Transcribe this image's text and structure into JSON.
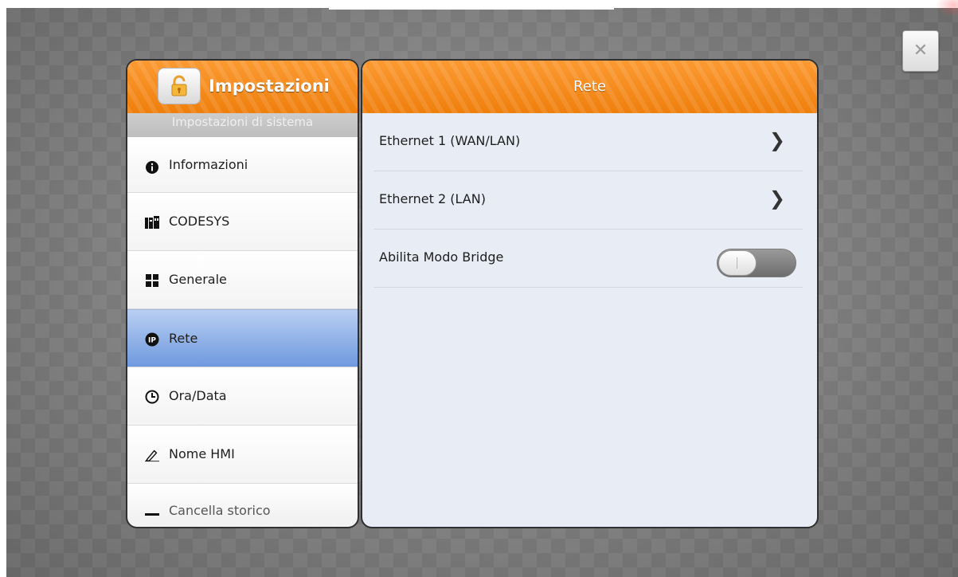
{
  "left_panel": {
    "title": "Impostazioni",
    "subheader": "Impostazioni di sistema",
    "items": [
      {
        "label": "Informazioni",
        "icon": "info-icon",
        "active": false
      },
      {
        "label": "CODESYS",
        "icon": "codesys-icon",
        "active": false
      },
      {
        "label": "Generale",
        "icon": "grid-icon",
        "active": false
      },
      {
        "label": "Rete",
        "icon": "ip-icon",
        "active": true
      },
      {
        "label": "Ora/Data",
        "icon": "clock-icon",
        "active": false
      },
      {
        "label": "Nome HMI",
        "icon": "pencil-icon",
        "active": false
      },
      {
        "label": "Cancella storico",
        "icon": "minus-icon",
        "active": false
      }
    ]
  },
  "right_panel": {
    "title": "Rete",
    "rows": [
      {
        "label": "Ethernet 1 (WAN/LAN)",
        "control": "chevron"
      },
      {
        "label": "Ethernet 2 (LAN)",
        "control": "chevron"
      },
      {
        "label": "Abilita Modo Bridge",
        "control": "toggle",
        "value": false
      }
    ]
  },
  "colors": {
    "header_orange": "#f28a1a",
    "active_blue": "#6f99de",
    "panel_bg": "#e8ecf4"
  }
}
